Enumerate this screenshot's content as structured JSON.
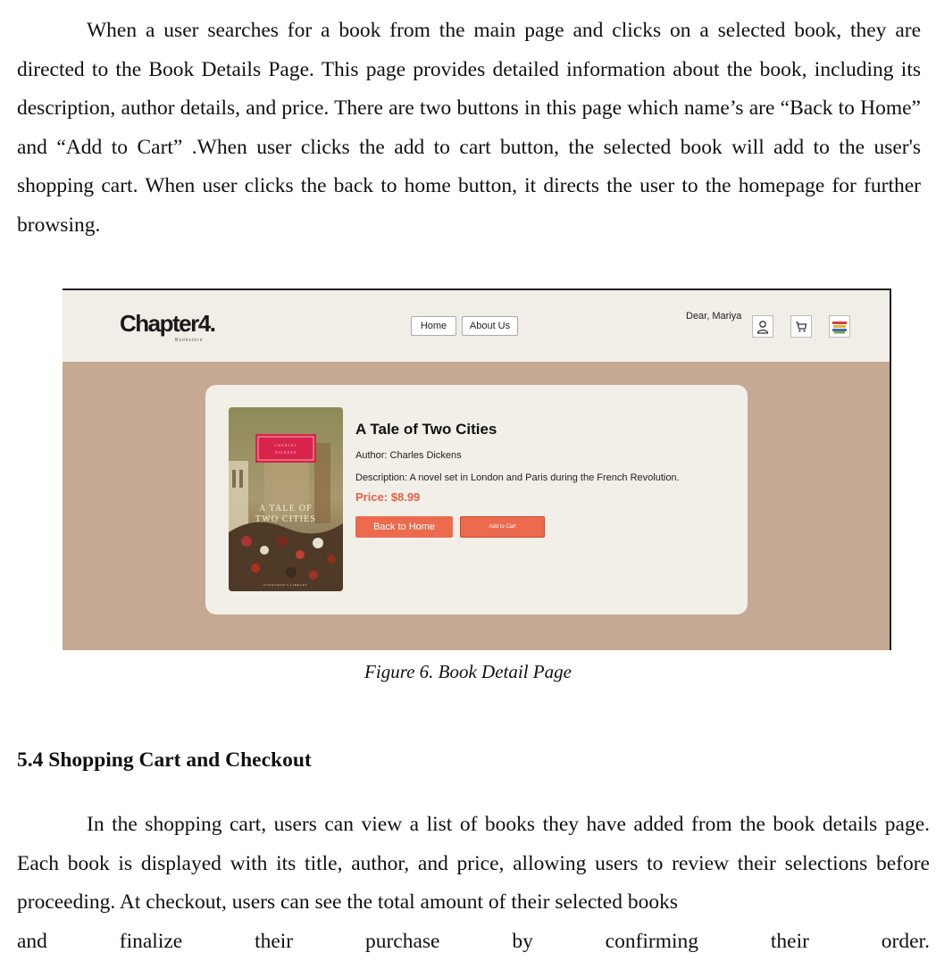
{
  "intro_paragraph": {
    "line1": "When a user searches for a book from the main page and clicks on a selected book, they",
    "rest": "are directed to the Book Details Page. This page provides detailed information about the book, including its description, author details, and price. There are two buttons in this page which name’s are “Back to Home” and “Add to Cart” .When user clicks the add to cart button, the selected book will add to the user's shopping cart. When user clicks the back to home button, it directs the user to the homepage for further browsing."
  },
  "figure": {
    "navbar": {
      "logo": "Chapter4.",
      "logo_sub": "Bookstore",
      "home_button": "Home",
      "about_button": "About Us",
      "greeting": "Dear, Mariya",
      "icons": [
        "user-icon",
        "cart-icon",
        "books-icon"
      ]
    },
    "book": {
      "title": "A Tale of Two Cities",
      "author": "Author: Charles Dickens",
      "description": "Description: A novel set in London and Paris during the French Revolution.",
      "price": "Price: $8.99",
      "back_button": "Back to Home",
      "cart_button": "Add to Cart",
      "cover": {
        "top_label_1": "CHARLES",
        "top_label_2": "DICKENS",
        "title_line1": "A TALE OF",
        "title_line2": "TWO CITIES",
        "bottom_label": "EVERYMAN'S LIBRARY"
      }
    },
    "caption": "Figure 6. Book Detail Page"
  },
  "section_heading": "5.4 Shopping Cart and Checkout",
  "cart_paragraph": {
    "text": "In the shopping cart, users can view a list of books they have added from the book details page. Each book is displayed with its title, author, and price, allowing users to review their selections before proceeding. At checkout, users can see the total amount of their selected books",
    "last_line_words": [
      "and",
      "finalize",
      "their",
      "purchase",
      "by",
      "confirming",
      "their",
      "order."
    ]
  },
  "colors": {
    "page_bg": "#c6a993",
    "navbar_bg": "#f1eee8",
    "card_bg": "#f2efe9",
    "accent": "#ec6a4e",
    "price": "#e0634a"
  }
}
